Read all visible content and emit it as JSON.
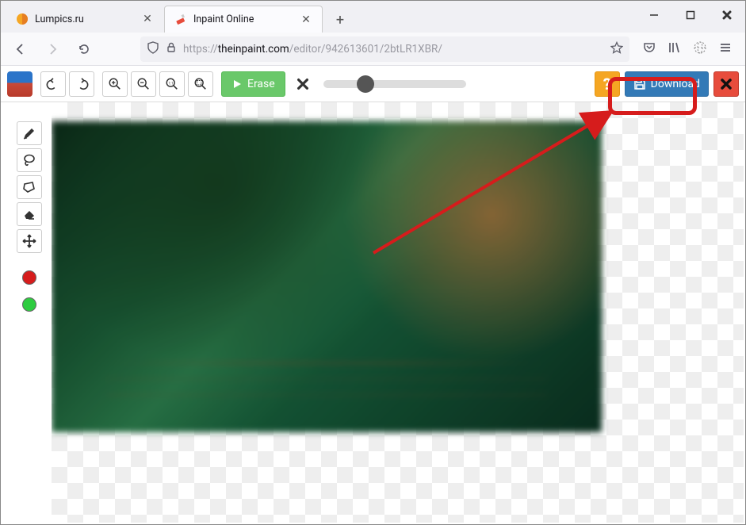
{
  "browser": {
    "tabs": [
      {
        "title": "Lumpics.ru",
        "active": false
      },
      {
        "title": "Inpaint Online",
        "active": true
      }
    ],
    "newtab_glyph": "+",
    "window": {
      "min": "—",
      "max": "▢",
      "close": "✕"
    },
    "url": {
      "prefix": "https://",
      "domain": "theinpaint.com",
      "path": "/editor/942613601/2btLR1XBR/"
    }
  },
  "toolbar": {
    "erase_label": "Erase",
    "download_label": "Download",
    "help_glyph": "?",
    "close_glyph": "✕",
    "cancel_glyph": "✕"
  },
  "sidetools": {
    "colors": {
      "red": "#d61c1c",
      "green": "#2ecc40"
    }
  },
  "accent": {
    "highlight": "#d61c1c",
    "download_bg": "#337ab7",
    "help_bg": "#f5a623",
    "erase_bg": "#6ac86a",
    "close_bg": "#e74c3c"
  }
}
